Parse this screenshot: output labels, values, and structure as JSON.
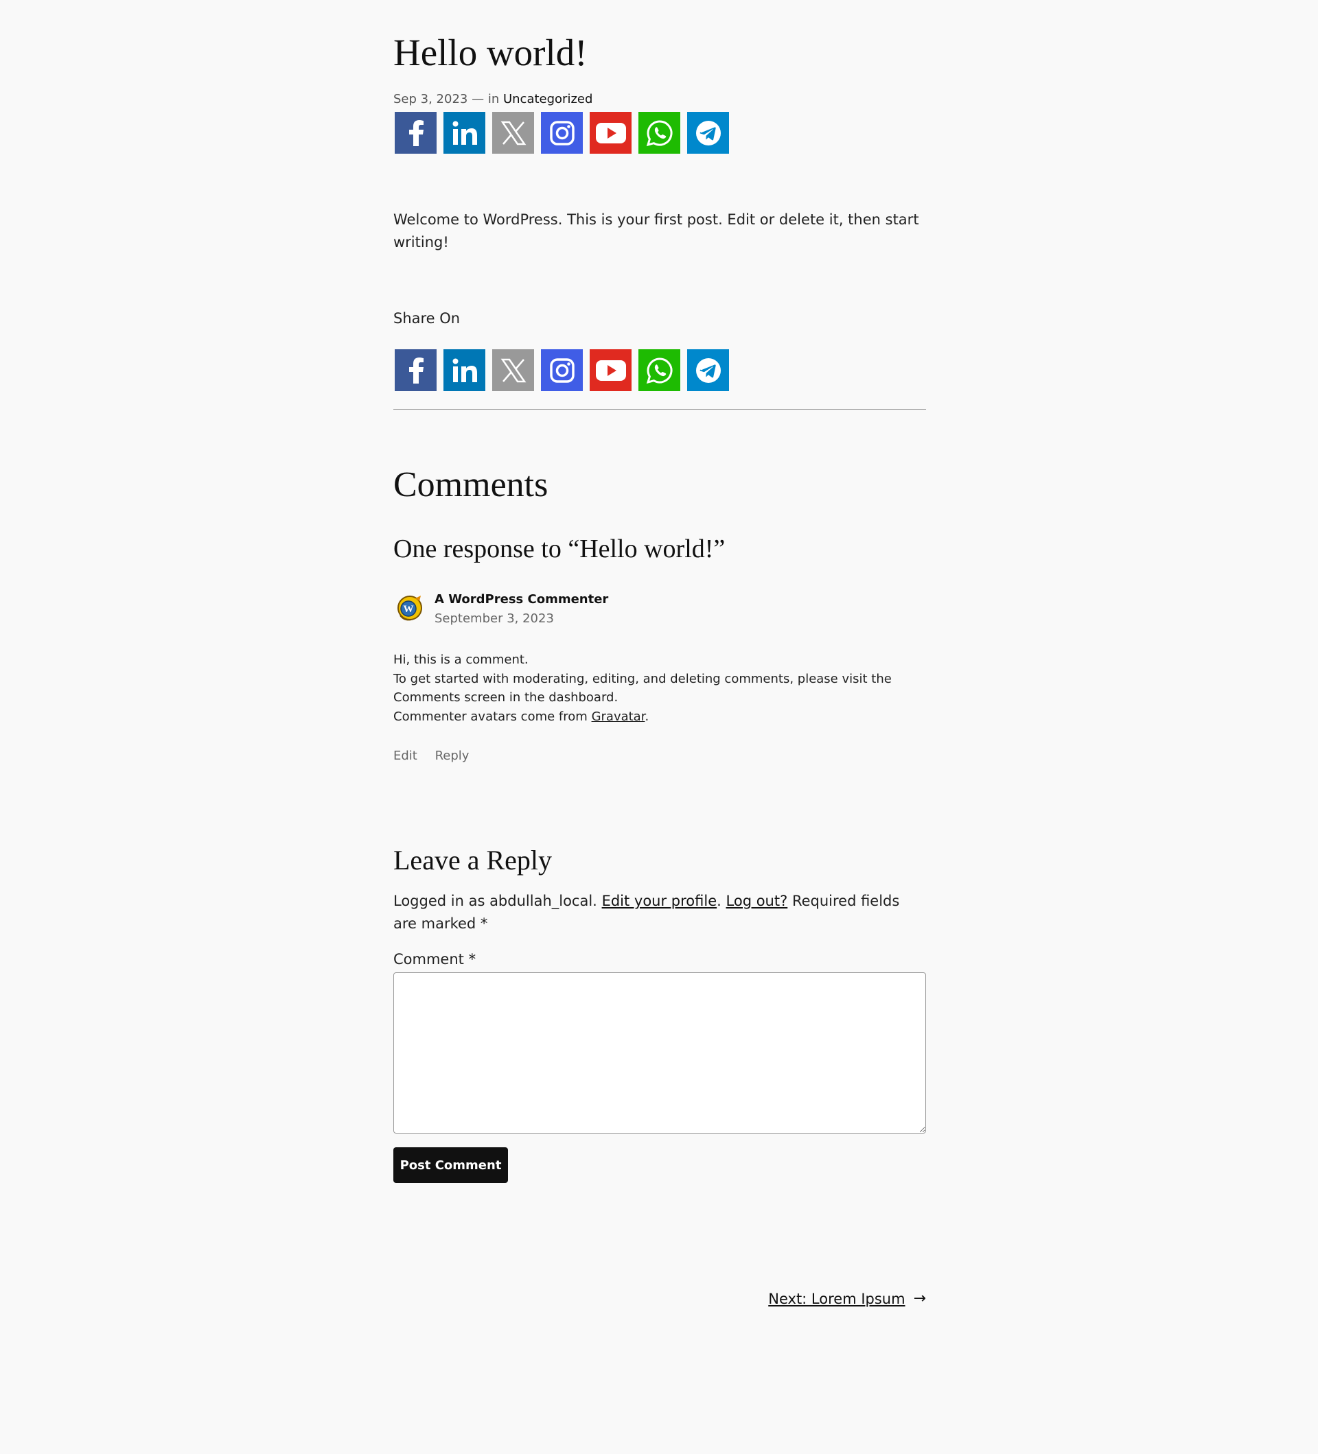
{
  "post": {
    "title": "Hello world!",
    "date": "Sep 3, 2023",
    "meta_in": "— in",
    "category": "Uncategorized",
    "body": "Welcome to WordPress. This is your first post. Edit or delete it, then start writing!"
  },
  "share": {
    "label": "Share On",
    "buttons": [
      {
        "icon": "facebook-icon",
        "color": "#3b5998"
      },
      {
        "icon": "linkedin-icon",
        "color": "#0077b5"
      },
      {
        "icon": "x-icon",
        "color": "#999999"
      },
      {
        "icon": "instagram-icon",
        "color": "#405de6"
      },
      {
        "icon": "youtube-icon",
        "color": "#e02a20"
      },
      {
        "icon": "whatsapp-icon",
        "color": "#1ebb02"
      },
      {
        "icon": "telegram-icon",
        "color": "#0088cc"
      }
    ]
  },
  "comments": {
    "title": "Comments",
    "responses_title": "One response to “Hello world!”",
    "items": [
      {
        "author": "A WordPress Commenter",
        "date": "September 3, 2023",
        "lines": [
          "Hi, this is a comment.",
          "To get started with moderating, editing, and deleting comments, please visit the Comments screen in the dashboard.",
          "Commenter avatars come from"
        ],
        "gravatar_link": "Gravatar",
        "gravatar_suffix": ".",
        "edit_label": "Edit",
        "reply_label": "Reply"
      }
    ]
  },
  "reply_form": {
    "title": "Leave a Reply",
    "logged_in_prefix": "Logged in as abdullah_local.",
    "edit_profile_link": "Edit your profile",
    "separator": ".",
    "logout_link": "Log out?",
    "required_note": "Required fields are marked *",
    "comment_label": "Comment *",
    "comment_value": "",
    "submit_label": "Post Comment"
  },
  "navigation": {
    "next_label": "Next: Lorem Ipsum",
    "next_arrow": "→"
  }
}
